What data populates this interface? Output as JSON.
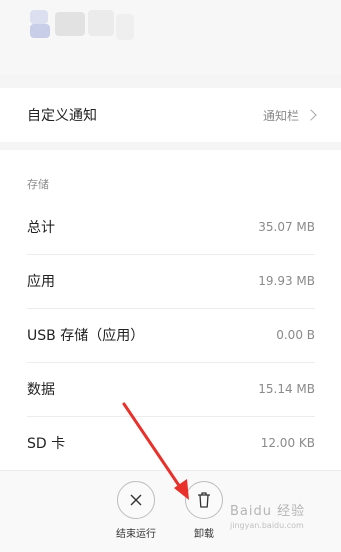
{
  "notification": {
    "label": "自定义通知",
    "value": "通知栏"
  },
  "storage": {
    "section_title": "存储",
    "rows": [
      {
        "label": "总计",
        "value": "35.07 MB"
      },
      {
        "label": "应用",
        "value": "19.93 MB"
      },
      {
        "label": "USB 存储（应用）",
        "value": "0.00 B"
      },
      {
        "label": "数据",
        "value": "15.14 MB"
      },
      {
        "label": "SD 卡",
        "value": "12.00 KB"
      }
    ]
  },
  "actions": {
    "stop_label": "结束运行",
    "uninstall_label": "卸载"
  },
  "annotation": {
    "color": "#e8312a"
  },
  "watermark": {
    "text": "Baidu 经验",
    "url": "jingyan.baidu.com"
  },
  "icons": {
    "notification_chevron": "chevron-right-icon",
    "stop": "close-icon",
    "uninstall": "trash-icon"
  }
}
